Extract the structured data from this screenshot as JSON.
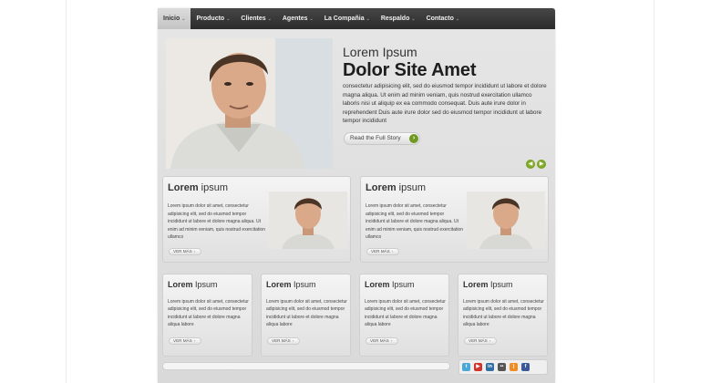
{
  "nav": {
    "items": [
      {
        "label": "Inicio",
        "active": true
      },
      {
        "label": "Producto",
        "active": false
      },
      {
        "label": "Clientes",
        "active": false
      },
      {
        "label": "Agentes",
        "active": false
      },
      {
        "label": "La Compañia",
        "active": false
      },
      {
        "label": "Respaldo",
        "active": false
      },
      {
        "label": "Contacto",
        "active": false
      }
    ],
    "caret": "⌄"
  },
  "hero": {
    "kicker": "Lorem Ipsum",
    "title": "Dolor Site Amet",
    "body": "consectetur adipisicing elit, sed do eiusmod tempor incididunt ut labore et dolore magna aliqua. Ut enim ad minim veniam, quis nostrud exercitation ullamco laboris nisi ut aliquip ex ea commodo consequat. Duis aute irure dolor in reprehendent Duis aute irure dolor sed do eiusmod tempor incididunt ut labore tempor incididunt",
    "button_label": "Read the Full Story",
    "button_icon": "arrow-right-icon",
    "accent_color": "#6f9a1f"
  },
  "medium_boxes": [
    {
      "title_bold": "Lorem",
      "title_rest": " ipsum",
      "body": "Lorem ipsum dolor sit amet, consectetur adipisicing elit, sed do eiusmod tempor incididunt ut labore et dolore magna aliqua. Ut enim ad minim veniam, quis nostrud exercitation ullamco",
      "link": "VER MÁS"
    },
    {
      "title_bold": "Lorem",
      "title_rest": " ipsum",
      "body": "Lorem ipsum dolor sit amet, consectetur adipisicing elit, sed do eiusmod tempor incididunt ut labore et dolore magna aliqua. Ut enim ad minim veniam, quis nostrud exercitation ullamco",
      "link": "VER MÁS"
    }
  ],
  "small_boxes": [
    {
      "title_bold": "Lorem",
      "title_rest": " Ipsum",
      "body": "Lorem ipsum dolor sit amet, consectetur adipisicing elit, sed do eiusmod tempor incididunt ut labore et dolore magna aliqua labore",
      "link": "VER MÁS"
    },
    {
      "title_bold": "Lorem",
      "title_rest": " Ipsum",
      "body": "Lorem ipsum dolor sit amet, consectetur adipisicing elit, sed do eiusmod tempor incididunt ut labore et dolore magna aliqua labore",
      "link": "VER MÁS"
    },
    {
      "title_bold": "Lorem",
      "title_rest": " Ipsum",
      "body": "Lorem ipsum dolor sit amet, consectetur adipisicing elit, sed do eiusmod tempor incididunt ut labore et dolore magna aliqua labore",
      "link": "VER MÁS"
    },
    {
      "title_bold": "Lorem",
      "title_rest": " Ipsum",
      "body": "Lorem ipsum dolor sit amet, consectetur adipisicing elit, sed do eiusmod tempor incididunt ut labore et dolore magna aliqua labore",
      "link": "VER MÁS"
    }
  ],
  "link_arrow": "›",
  "social": [
    {
      "icon": "twitter-icon",
      "glyph": "t",
      "color": "#4aa8d8"
    },
    {
      "icon": "youtube-icon",
      "glyph": "▶",
      "color": "#d0342c"
    },
    {
      "icon": "linkedin-icon",
      "glyph": "in",
      "color": "#2f6fa4"
    },
    {
      "icon": "flickr-icon",
      "glyph": "••",
      "color": "#555555"
    },
    {
      "icon": "rss-icon",
      "glyph": ")",
      "color": "#f08c24"
    },
    {
      "icon": "facebook-icon",
      "glyph": "f",
      "color": "#3b5998"
    }
  ]
}
